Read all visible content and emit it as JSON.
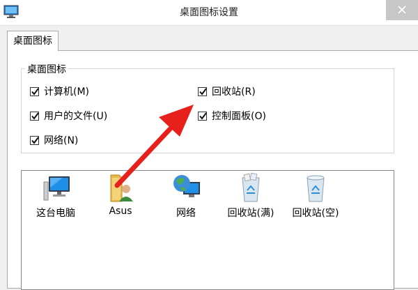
{
  "window": {
    "title": "桌面图标设置"
  },
  "tabs": [
    {
      "label": "桌面图标",
      "selected": true
    }
  ],
  "desktop_icons_group": {
    "legend": "桌面图标",
    "checkboxes": [
      {
        "label": "计算机(M)",
        "checked": true
      },
      {
        "label": "回收站(R)",
        "checked": true
      },
      {
        "label": "用户的文件(U)",
        "checked": true
      },
      {
        "label": "控制面板(O)",
        "checked": true
      },
      {
        "label": "网络(N)",
        "checked": true
      }
    ]
  },
  "icon_list": [
    {
      "label": "这台电脑",
      "icon": "computer-icon"
    },
    {
      "label": "Asus",
      "icon": "user-folder-icon"
    },
    {
      "label": "网络",
      "icon": "network-globe-icon"
    },
    {
      "label": "回收站(满)",
      "icon": "recycle-bin-full-icon"
    },
    {
      "label": "回收站(空)",
      "icon": "recycle-bin-empty-icon"
    }
  ],
  "colors": {
    "annotation_arrow": "#e8201c",
    "close_button": "#c7c7c7"
  }
}
